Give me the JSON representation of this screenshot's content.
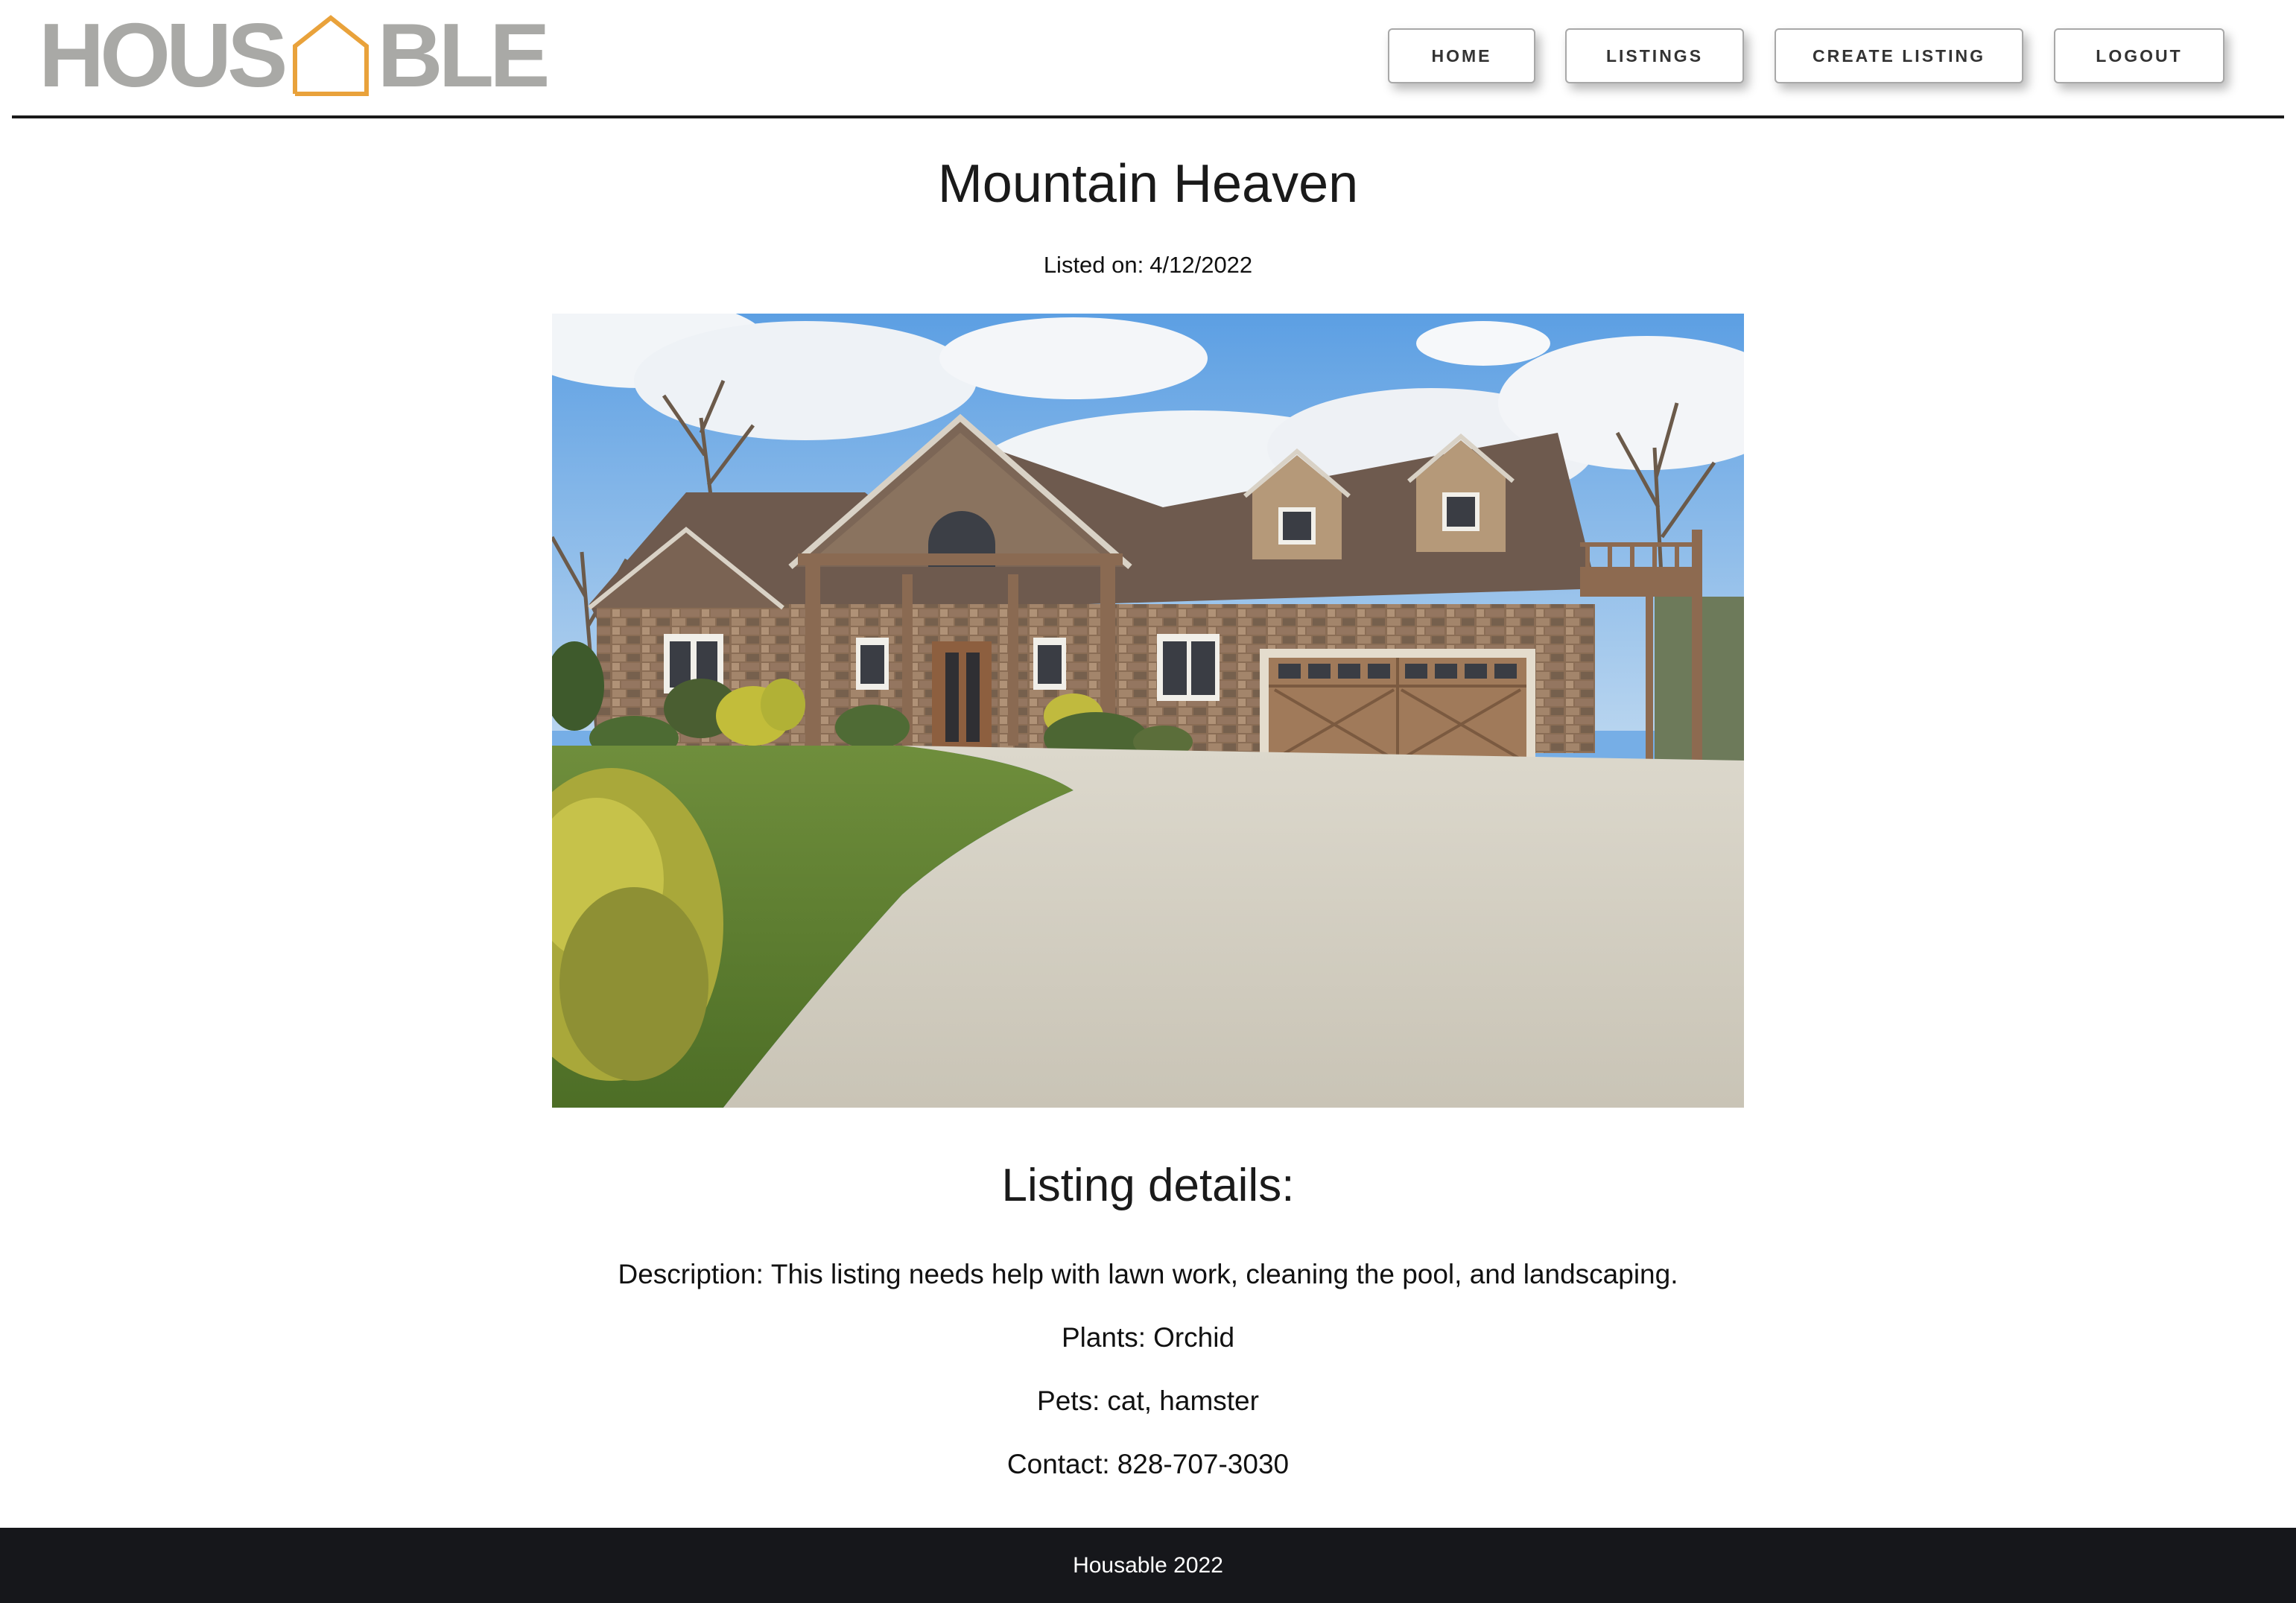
{
  "brand": {
    "logo_text_left": "HOUS",
    "logo_text_right": "BLE",
    "logo_icon": "house-outline-icon",
    "logo_text_color": "#a9a9a6",
    "logo_accent_color": "#e9a23b"
  },
  "nav": {
    "items": [
      {
        "label": "HOME"
      },
      {
        "label": "LISTINGS"
      },
      {
        "label": "CREATE LISTING"
      },
      {
        "label": "LOGOUT"
      }
    ]
  },
  "listing": {
    "title": "Mountain Heaven",
    "listed_on_label": "Listed on:",
    "listed_on_date": "4/12/2022",
    "photo": "house-photo",
    "details_heading": "Listing details:",
    "description_label": "Description:",
    "description": "This listing needs help with lawn work, cleaning the pool, and landscaping.",
    "plants_label": "Plants:",
    "plants": "Orchid",
    "pets_label": "Pets:",
    "pets": "cat, hamster",
    "contact_label": "Contact:",
    "contact": "828-707-3030"
  },
  "footer": {
    "text": "Housable 2022",
    "background": "#16171b"
  }
}
